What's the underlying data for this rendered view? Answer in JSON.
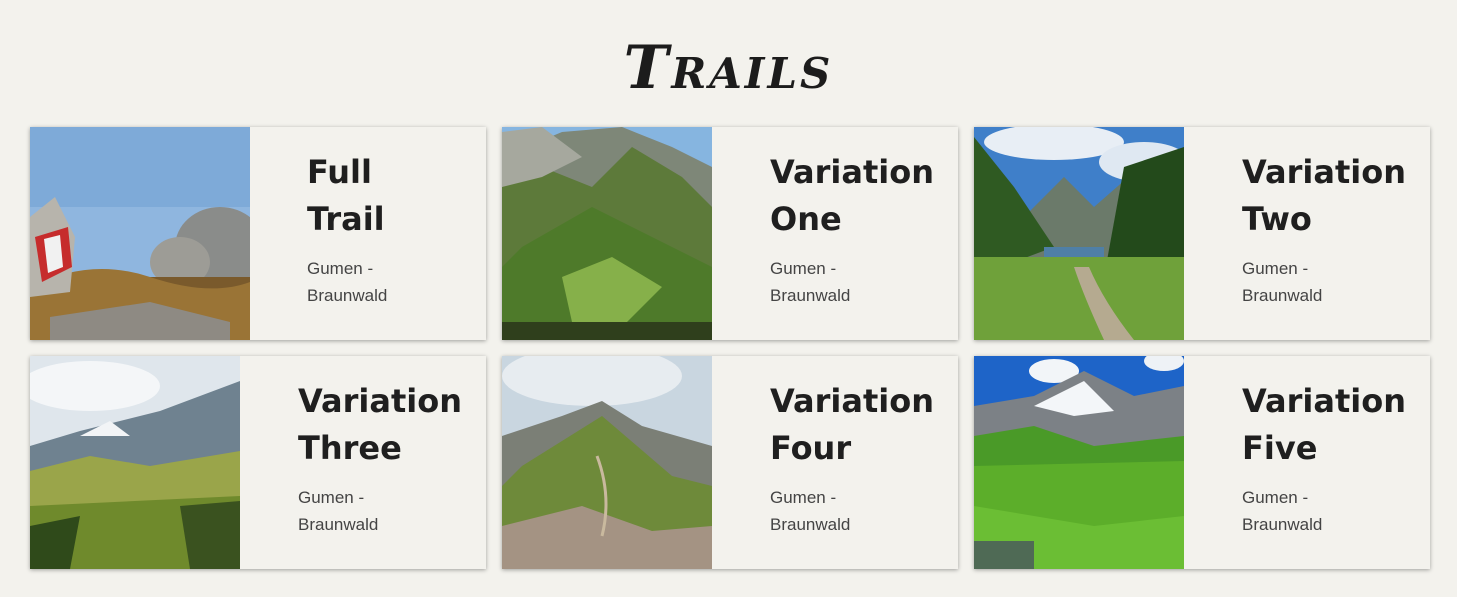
{
  "page": {
    "title": "Trails"
  },
  "cards": [
    {
      "title": "Full Trail",
      "subtitle": "Gumen - Braunwald",
      "image": "trail-marker-photo"
    },
    {
      "title": "Variation One",
      "subtitle": "Gumen - Braunwald",
      "image": "mountain-valley-photo"
    },
    {
      "title": "Variation Two",
      "subtitle": "Gumen - Braunwald",
      "image": "lake-path-photo"
    },
    {
      "title": "Variation Three",
      "subtitle": "Gumen - Braunwald",
      "image": "alpine-meadow-photo"
    },
    {
      "title": "Variation Four",
      "subtitle": "Gumen - Braunwald",
      "image": "ridge-trail-photo"
    },
    {
      "title": "Variation Five",
      "subtitle": "Gumen - Braunwald",
      "image": "glacier-meadow-photo"
    }
  ]
}
